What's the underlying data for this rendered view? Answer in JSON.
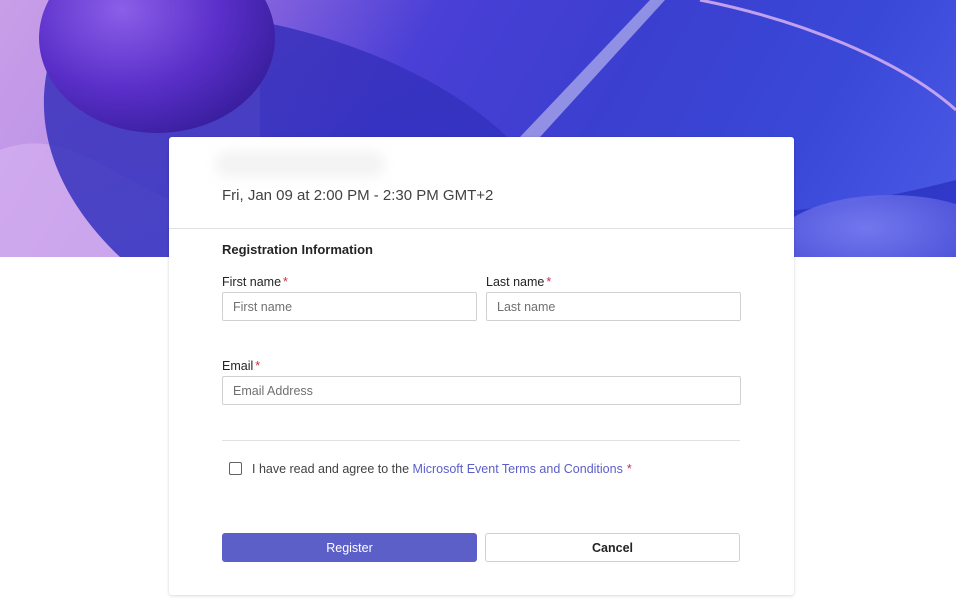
{
  "event": {
    "date_time": "Fri, Jan 09 at 2:00 PM - 2:30 PM GMT+2"
  },
  "form": {
    "section_title": "Registration Information",
    "required_mark": "*",
    "first_name": {
      "label": "First name",
      "placeholder": "First name",
      "value": ""
    },
    "last_name": {
      "label": "Last name",
      "placeholder": "Last name",
      "value": ""
    },
    "email": {
      "label": "Email",
      "placeholder": "Email Address",
      "value": ""
    },
    "terms": {
      "prefix": "I have read and agree to the ",
      "link_text": "Microsoft Event Terms and Conditions",
      "checked": false
    },
    "register_label": "Register",
    "cancel_label": "Cancel"
  },
  "colors": {
    "accent": "#5b5fc7",
    "required": "#c4314b",
    "hero_primary": "#3b3fcf"
  }
}
